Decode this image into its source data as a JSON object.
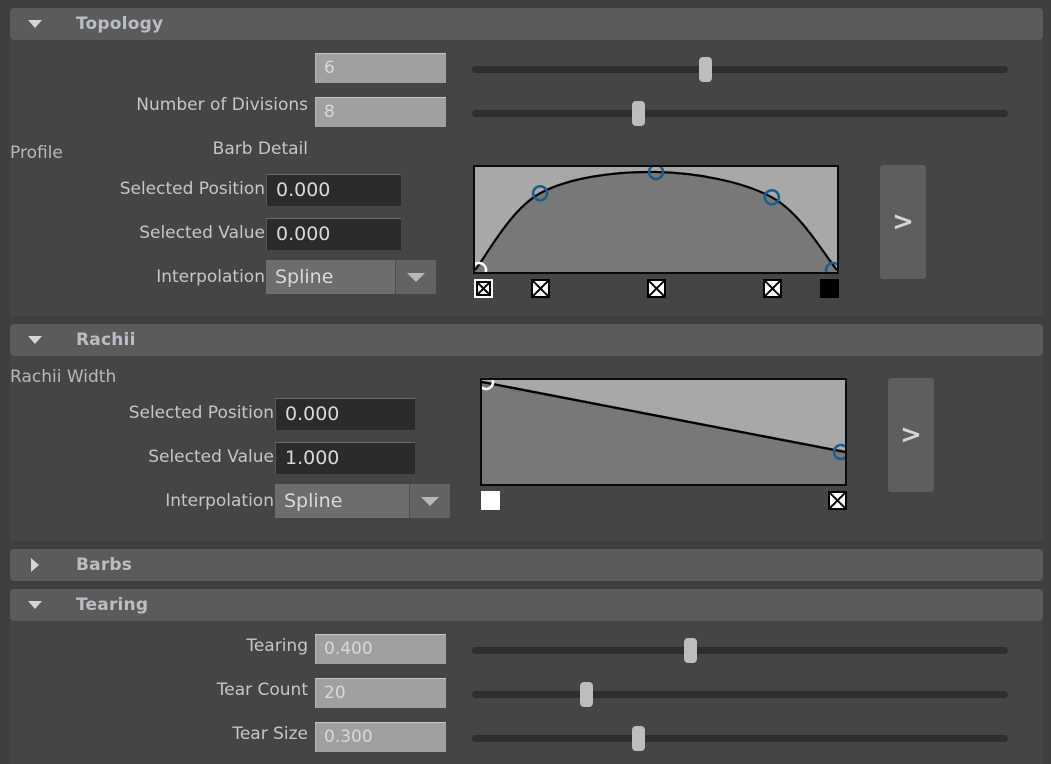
{
  "sections": [
    {
      "id": "topology",
      "title": "Topology",
      "expanded": true,
      "triangle_icon": "triangle-down-icon"
    },
    {
      "id": "rachii",
      "title": "Rachii",
      "expanded": true,
      "triangle_icon": "triangle-down-icon"
    },
    {
      "id": "barbs",
      "title": "Barbs",
      "expanded": false,
      "triangle_icon": "triangle-right-icon"
    },
    {
      "id": "tearing",
      "title": "Tearing",
      "expanded": true,
      "triangle_icon": "triangle-down-icon"
    }
  ],
  "topology": {
    "rows": [
      {
        "label": "Number of Divisions",
        "value": "6",
        "slider_percent": 43.5
      },
      {
        "label": "Barb Detail",
        "value": "8",
        "slider_percent": 31.0
      }
    ],
    "profile": {
      "group_label": "Profile",
      "selected_position_label": "Selected Position",
      "selected_position_value": "0.000",
      "selected_value_label": "Selected Value",
      "selected_value_value": "0.000",
      "interpolation_label": "Interpolation",
      "interpolation_value": "Spline",
      "expand_button_label": ">",
      "curve": {
        "points": [
          {
            "x": 0.0,
            "y": 0.0
          },
          {
            "x": 0.18,
            "y": 0.76
          },
          {
            "x": 0.5,
            "y": 0.97
          },
          {
            "x": 0.82,
            "y": 0.72
          },
          {
            "x": 1.0,
            "y": 0.0
          }
        ],
        "key_markers": [
          {
            "x": 0.0,
            "type": "xbox",
            "selected": true
          },
          {
            "x": 0.18,
            "type": "xbox",
            "selected": false
          },
          {
            "x": 0.5,
            "type": "xbox",
            "selected": false
          },
          {
            "x": 0.82,
            "type": "xbox",
            "selected": false
          },
          {
            "x": 1.0,
            "type": "solid",
            "selected": false
          }
        ]
      }
    }
  },
  "rachii": {
    "group_label": "Rachii Width",
    "selected_position_label": "Selected Position",
    "selected_position_value": "0.000",
    "selected_value_label": "Selected Value",
    "selected_value_value": "1.000",
    "interpolation_label": "Interpolation",
    "interpolation_value": "Spline",
    "expand_button_label": ">",
    "curve": {
      "points": [
        {
          "x": 0.0,
          "y": 1.0
        },
        {
          "x": 1.0,
          "y": 0.3
        }
      ],
      "key_markers": [
        {
          "x": 0.0,
          "type": "whitesq",
          "selected": true
        },
        {
          "x": 1.0,
          "type": "xbox",
          "selected": false
        }
      ]
    }
  },
  "tearing": {
    "rows": [
      {
        "label": "Tearing",
        "value": "0.400",
        "slider_percent": 40.7
      },
      {
        "label": "Tear Count",
        "value": "20",
        "slider_percent": 21.3
      },
      {
        "label": "Tear Size",
        "value": "0.300",
        "slider_percent": 31.0
      }
    ]
  },
  "colors": {
    "panel_bg": "#3f3f3f",
    "section_body_bg": "#454545",
    "header_bg": "#5b5b5b",
    "header_text": "#b9bec4",
    "label_text": "#c6c6c6",
    "num_field_bg": "#a0a0a0",
    "dark_field_bg": "#2b2b2b",
    "slider_track": "#2e2e2e",
    "slider_handle": "#bdbdbd",
    "graph_fill_upper": "#a8a8a8",
    "graph_fill_lower": "#787878",
    "curve_stroke": "#000000",
    "control_point_stroke": "#1b5e8c",
    "control_point_selected": "#ffffff"
  }
}
